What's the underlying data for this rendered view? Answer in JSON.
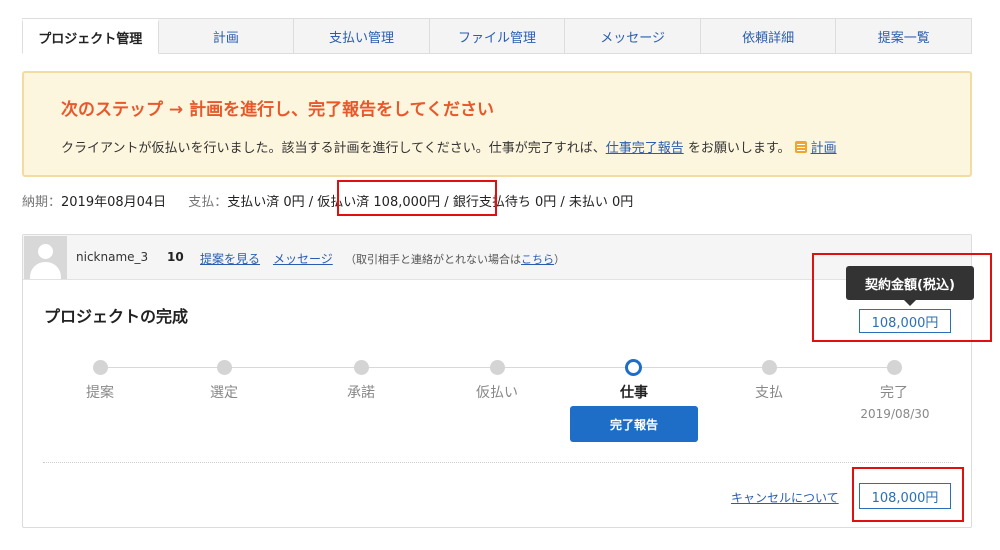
{
  "tabs": [
    {
      "label": "プロジェクト管理",
      "active": true
    },
    {
      "label": "計画"
    },
    {
      "label": "支払い管理"
    },
    {
      "label": "ファイル管理"
    },
    {
      "label": "メッセージ"
    },
    {
      "label": "依頼詳細"
    },
    {
      "label": "提案一覧"
    }
  ],
  "notice": {
    "title": "次のステップ → 計画を進行し、完了報告をしてください",
    "text_before": "クライアントが仮払いを行いました。該当する計画を進行してください。仕事が完了すれば、",
    "report_link": "仕事完了報告",
    "text_after": "をお願いします。",
    "plan_link": "計画"
  },
  "status": {
    "deadline_label": "納期：",
    "deadline_value": "2019年08月04日",
    "payment_label": "支払：",
    "paid": "支払い済 0円 /",
    "escrow": "仮払い済 108,000円 /",
    "bank_pending": "銀行支払待ち 0円 /",
    "unpaid": "未払い 0円"
  },
  "card": {
    "nickname": "nickname_3",
    "score": "10",
    "view_proposal": "提案を見る",
    "message_link": "メッセージ",
    "contact_note_before": "（取引相手と連絡がとれない場合は",
    "contact_link": "こちら",
    "contact_note_after": "）",
    "project_title": "プロジェクトの完成",
    "tooltip": "契約金額(税込)",
    "contract_amount": "108,000円",
    "bottom_amount": "108,000円",
    "cancel_link": "キャンセルについて",
    "report_button": "完了報告"
  },
  "steps": [
    {
      "label": "提案"
    },
    {
      "label": "選定"
    },
    {
      "label": "承諾"
    },
    {
      "label": "仮払い"
    },
    {
      "label": "仕事",
      "current": true
    },
    {
      "label": "支払"
    },
    {
      "label": "完了",
      "date": "2019/08/30"
    }
  ]
}
